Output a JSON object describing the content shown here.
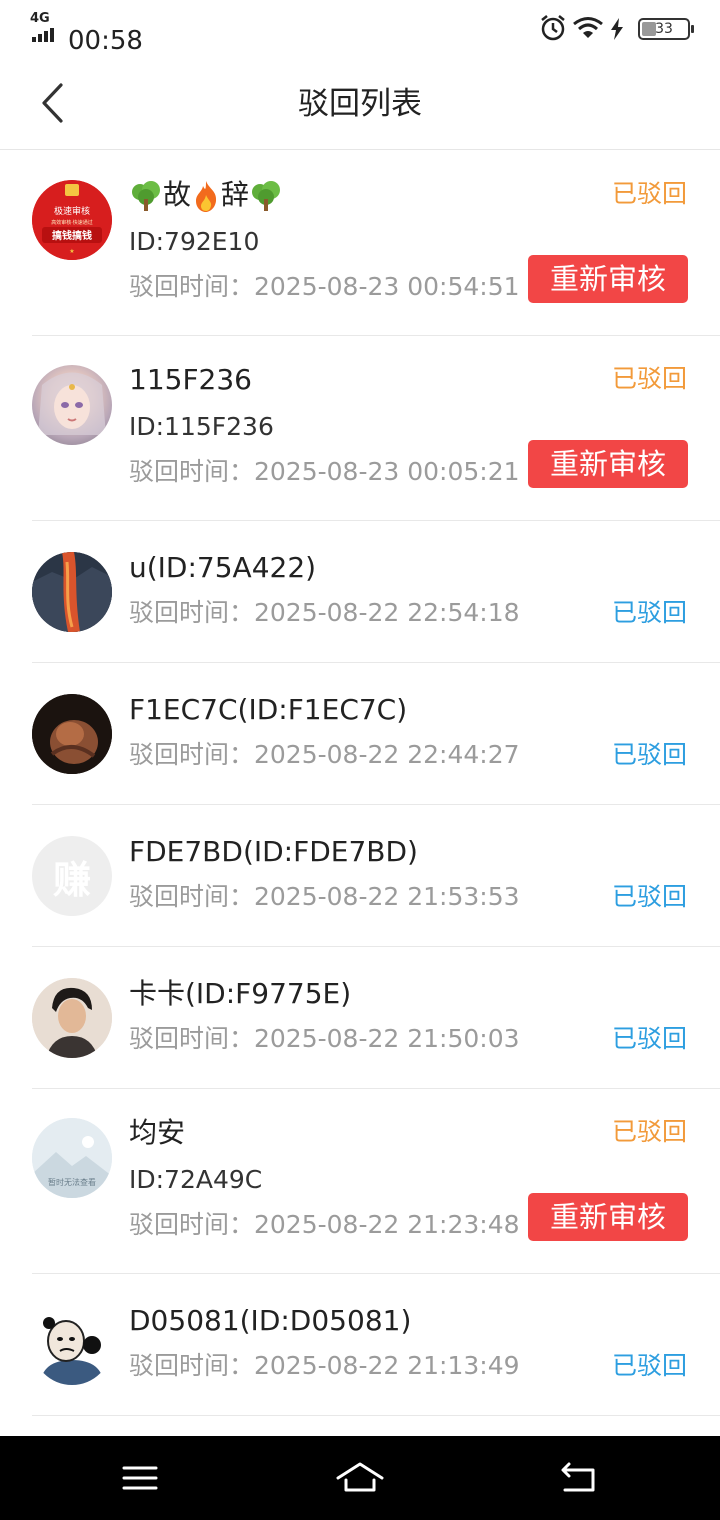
{
  "status_bar": {
    "network": "4G",
    "time": "00:58",
    "battery": "33"
  },
  "header": {
    "title": "驳回列表"
  },
  "items": [
    {
      "name_parts": [
        "故",
        "辞"
      ],
      "id_line": "ID:792E10",
      "time": "驳回时间：2025-08-23 00:54:51",
      "status": "已驳回",
      "button": "重新审核",
      "avatar": {
        "line1": "极速审核",
        "line2": "高效审核·快速通过",
        "line3": "搞钱搞钱"
      }
    },
    {
      "name": "115F236",
      "id_line": "ID:115F236",
      "time": "驳回时间：2025-08-23 00:05:21",
      "status": "已驳回",
      "button": "重新审核"
    },
    {
      "name": "u(ID:75A422)",
      "time": "驳回时间：2025-08-22 22:54:18",
      "status": "已驳回"
    },
    {
      "name": "F1EC7C(ID:F1EC7C)",
      "time": "驳回时间：2025-08-22 22:44:27",
      "status": "已驳回"
    },
    {
      "name": "FDE7BD(ID:FDE7BD)",
      "time": "驳回时间：2025-08-22 21:53:53",
      "status": "已驳回",
      "avatar_text": "赚"
    },
    {
      "name": "卡卡(ID:F9775E)",
      "time": "驳回时间：2025-08-22 21:50:03",
      "status": "已驳回"
    },
    {
      "name": "均安",
      "id_line": "ID:72A49C",
      "time": "驳回时间：2025-08-22 21:23:48",
      "status": "已驳回",
      "button": "重新审核",
      "avatar_text": "暂时无法查看"
    },
    {
      "name": "D05081(ID:D05081)",
      "time": "驳回时间：2025-08-22 21:13:49",
      "status": "已驳回"
    }
  ],
  "colors": {
    "status_orange": "#f29a3a",
    "status_blue": "#2d9ee0",
    "button_red": "#f24646"
  }
}
